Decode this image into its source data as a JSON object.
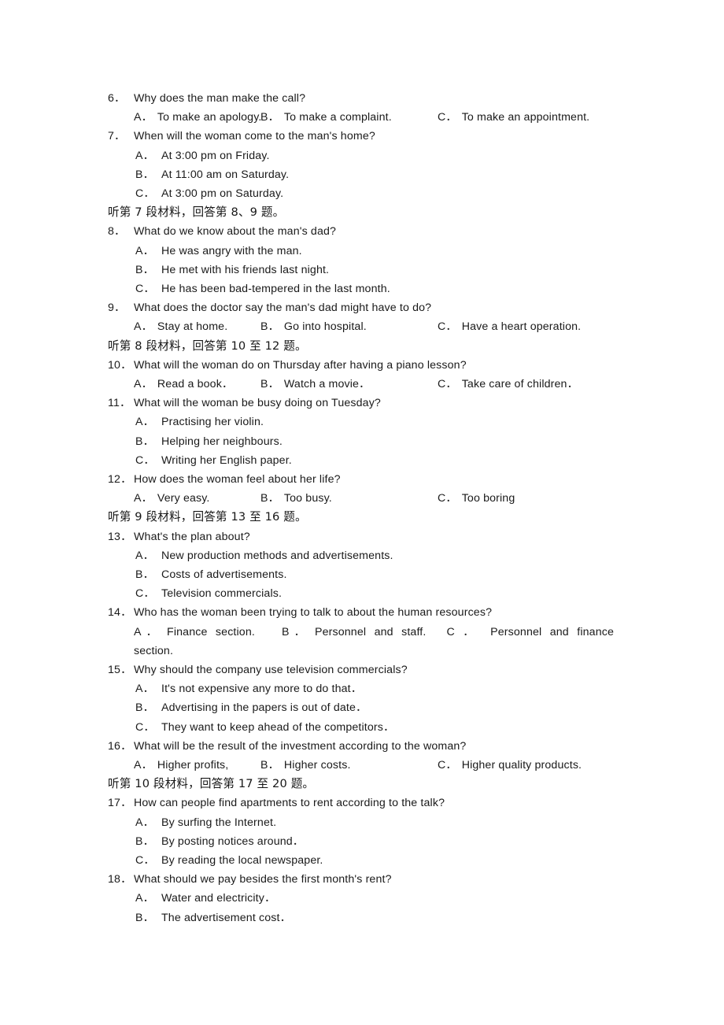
{
  "document": {
    "section_label": "listening-comprehension",
    "page_background": "#ffffff",
    "text_color": "#1a1a1a"
  },
  "blocks": [
    {
      "kind": "question",
      "number": "6．",
      "stem": "Why does the man make the call?",
      "layout": "inline-three-column",
      "options": [
        {
          "letter": "A．",
          "text": "To make an apology."
        },
        {
          "letter": "B．",
          "text": "To make a complaint."
        },
        {
          "letter": "C．",
          "text": "To make an appointment."
        }
      ]
    },
    {
      "kind": "question",
      "number": "7．",
      "stem": "When will the woman come to the man's home?",
      "layout": "stacked",
      "options": [
        {
          "letter": "A．",
          "text": "At 3:00 pm on Friday."
        },
        {
          "letter": "B．",
          "text": "At 11:00 am on Saturday."
        },
        {
          "letter": "C．",
          "text": "At 3:00 pm on Saturday."
        }
      ]
    },
    {
      "kind": "directive",
      "text": "听第 7 段材料，回答第 8、9 题。"
    },
    {
      "kind": "question",
      "number": "8．",
      "stem": "What do we know about the man's dad?",
      "layout": "stacked",
      "options": [
        {
          "letter": "A．",
          "text": "He was angry with the man."
        },
        {
          "letter": "B．",
          "text": "He met with his friends last night."
        },
        {
          "letter": "C．",
          "text": "He has been bad-tempered in the last month."
        }
      ]
    },
    {
      "kind": "question",
      "number": "9．",
      "stem": "What does the doctor say the man's dad might have to do?",
      "layout": "inline-three-column",
      "options": [
        {
          "letter": "A．",
          "text": "Stay at home."
        },
        {
          "letter": "B．",
          "text": "Go into hospital."
        },
        {
          "letter": "C．",
          "text": "Have a heart operation."
        }
      ]
    },
    {
      "kind": "directive",
      "text": "听第 8 段材料，回答第 10 至 12 题。"
    },
    {
      "kind": "question",
      "number": "10．",
      "stem": "What will the woman do on Thursday after having a piano lesson?",
      "layout": "inline-three-column",
      "options": [
        {
          "letter": "A．",
          "text": "Read a book．"
        },
        {
          "letter": "B．",
          "text": "Watch a movie．"
        },
        {
          "letter": "C．",
          "text": "Take care of children．"
        }
      ]
    },
    {
      "kind": "question",
      "number": "11．",
      "stem": "What will the woman be busy doing on Tuesday?",
      "layout": "stacked",
      "options": [
        {
          "letter": "A．",
          "text": "Practising her violin."
        },
        {
          "letter": "B．",
          "text": "Helping her neighbours."
        },
        {
          "letter": "C．",
          "text": "Writing her English paper."
        }
      ]
    },
    {
      "kind": "question",
      "number": "12．",
      "stem": "How does the woman feel about her life?",
      "layout": "inline-three-column",
      "options": [
        {
          "letter": "A．",
          "text": "Very easy."
        },
        {
          "letter": "B．",
          "text": "Too busy."
        },
        {
          "letter": "C．",
          "text": "Too boring"
        }
      ]
    },
    {
      "kind": "directive",
      "text": "听第 9 段材料，回答第 13 至 16 题。"
    },
    {
      "kind": "question",
      "number": "13．",
      "stem": "What's the plan about?",
      "layout": "stacked",
      "options": [
        {
          "letter": "A．",
          "text": "New production methods and advertisements."
        },
        {
          "letter": "B．",
          "text": "Costs of advertisements."
        },
        {
          "letter": "C．",
          "text": "Television commercials."
        }
      ]
    },
    {
      "kind": "question",
      "number": "14．",
      "stem": "Who has the woman been trying to talk to about the human resources?",
      "layout": "justified-wrap",
      "options": [
        {
          "letter": "A．",
          "text": "Finance section."
        },
        {
          "letter": "B．",
          "text": "Personnel and staff."
        },
        {
          "letter": "C．",
          "text": "Personnel and finance section.",
          "letter_spaced": "C ．",
          "head": "Personnel   and   finance",
          "tail": "section."
        }
      ]
    },
    {
      "kind": "question",
      "number": "15．",
      "stem": "Why should the company use television commercials?",
      "layout": "stacked",
      "options": [
        {
          "letter": "A．",
          "text": "It's not expensive any more to do that．"
        },
        {
          "letter": "B．",
          "text": "Advertising in the papers is out of date．"
        },
        {
          "letter": "C．",
          "text": "They want to keep ahead of the competitors．"
        }
      ]
    },
    {
      "kind": "question",
      "number": "16．",
      "stem": "What will be the result of the investment according to the woman?",
      "layout": "inline-three-column",
      "options": [
        {
          "letter": "A．",
          "text": "Higher profits,"
        },
        {
          "letter": "B．",
          "text": "Higher costs."
        },
        {
          "letter": "C．",
          "text": "Higher quality products."
        }
      ]
    },
    {
      "kind": "directive",
      "text": "听第 10 段材料，回答第 17 至 20 题。"
    },
    {
      "kind": "question",
      "number": "17．",
      "stem": "How can people find apartments to rent according to the talk?",
      "layout": "stacked",
      "options": [
        {
          "letter": "A．",
          "text": "By surfing the Internet."
        },
        {
          "letter": "B．",
          "text": "By posting notices around．"
        },
        {
          "letter": "C．",
          "text": "By reading the local newspaper."
        }
      ]
    },
    {
      "kind": "question",
      "number": "18．",
      "stem": "What should we pay besides the first month's rent?",
      "layout": "stacked",
      "options": [
        {
          "letter": "A．",
          "text": "Water and electricity．"
        },
        {
          "letter": "B．",
          "text": "The advertisement cost．"
        }
      ]
    }
  ]
}
